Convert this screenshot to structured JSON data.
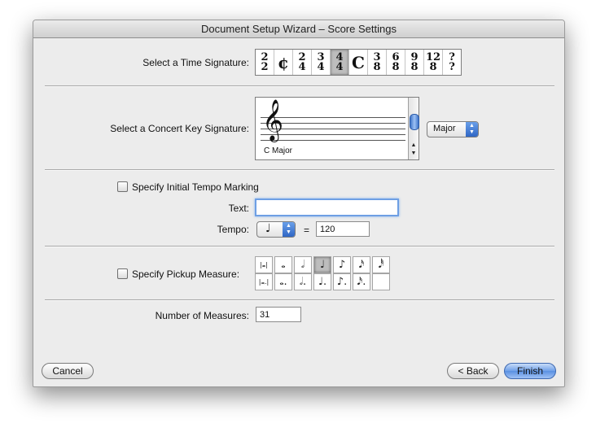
{
  "window": {
    "title": "Document Setup Wizard – Score Settings"
  },
  "time_signature": {
    "label": "Select a Time Signature:",
    "options": [
      {
        "top": "2",
        "bottom": "2"
      },
      {
        "symbol": "¢"
      },
      {
        "top": "2",
        "bottom": "4"
      },
      {
        "top": "3",
        "bottom": "4"
      },
      {
        "top": "4",
        "bottom": "4"
      },
      {
        "symbol": "C"
      },
      {
        "top": "3",
        "bottom": "8"
      },
      {
        "top": "6",
        "bottom": "8"
      },
      {
        "top": "9",
        "bottom": "8"
      },
      {
        "top": "12",
        "bottom": "8"
      },
      {
        "top": "?",
        "bottom": "?"
      }
    ],
    "selected_index": 4
  },
  "key_signature": {
    "label": "Select a Concert Key Signature:",
    "clef_icon": "𝄞",
    "key_name": "C Major",
    "mode_value": "Major"
  },
  "tempo": {
    "checkbox_label": "Specify Initial Tempo Marking",
    "text_label": "Text:",
    "text_value": "",
    "tempo_label": "Tempo:",
    "note_icon": "♩",
    "equals": "=",
    "tempo_value": "120"
  },
  "pickup": {
    "checkbox_label": "Specify Pickup Measure:",
    "row1": [
      "|𝅜|",
      "𝅝",
      "𝅗𝅥",
      "♩",
      "♪",
      "𝅘𝅥𝅯",
      "𝅘𝅥𝅰"
    ],
    "row2": [
      "|𝅜.|",
      "𝅝.",
      "𝅗𝅥.",
      "♩.",
      "♪.",
      "𝅘𝅥𝅯.",
      ""
    ],
    "selected_row1_index": 3
  },
  "measures": {
    "label": "Number of Measures:",
    "value": "31"
  },
  "buttons": {
    "cancel": "Cancel",
    "back": "< Back",
    "finish": "Finish"
  }
}
